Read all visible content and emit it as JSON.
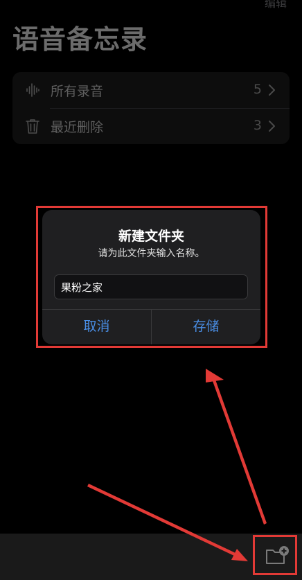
{
  "header": {
    "edit_label": "编辑",
    "title": "语音备忘录"
  },
  "folders": [
    {
      "icon": "waveform-icon",
      "label": "所有录音",
      "count": "5"
    },
    {
      "icon": "trash-icon",
      "label": "最近删除",
      "count": "3"
    }
  ],
  "dialog": {
    "title": "新建文件夹",
    "message": "请为此文件夹输入名称。",
    "input_value": "果粉之家",
    "cancel_label": "取消",
    "save_label": "存储"
  },
  "toolbar": {
    "new_folder_icon": "new-folder-icon"
  },
  "colors": {
    "accent": "#4a8fe7",
    "annotation": "#e23a36",
    "dialog_bg": "#1f1f21"
  }
}
